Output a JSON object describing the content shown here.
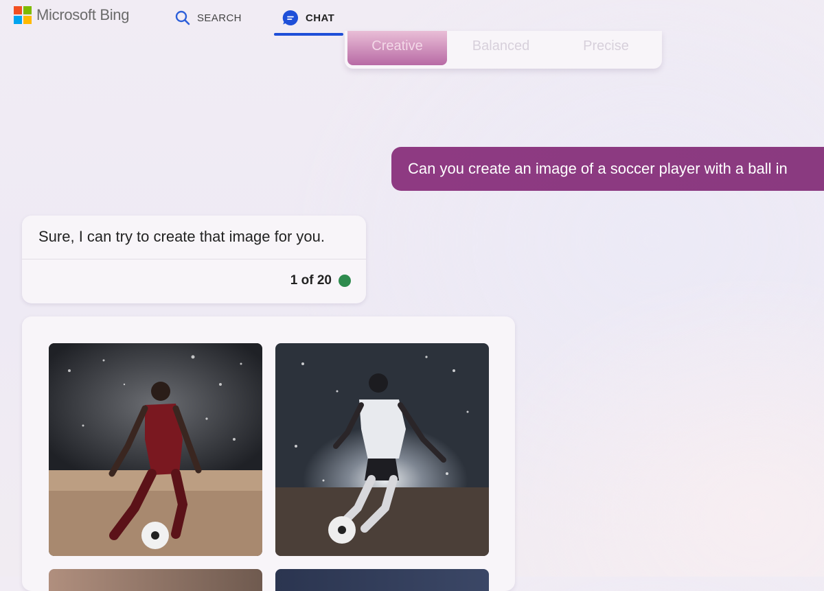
{
  "header": {
    "brand": "Microsoft Bing",
    "nav": [
      {
        "label": "SEARCH",
        "icon": "search-icon"
      },
      {
        "label": "CHAT",
        "icon": "chat-icon",
        "active": true
      }
    ]
  },
  "tone_selector": {
    "options": [
      "Creative",
      "Balanced",
      "Precise"
    ],
    "selected": "Creative"
  },
  "conversation": {
    "user_message": "Can you create an image of a soccer player with a ball in",
    "bot_message": "Sure, I can try to create that image for you.",
    "turn_counter": "1 of 20"
  },
  "image_results": {
    "count": 4
  },
  "colors": {
    "accent": "#1e4fd8",
    "user_bubble": "#8e3a82",
    "status_dot": "#2e8b4e"
  }
}
